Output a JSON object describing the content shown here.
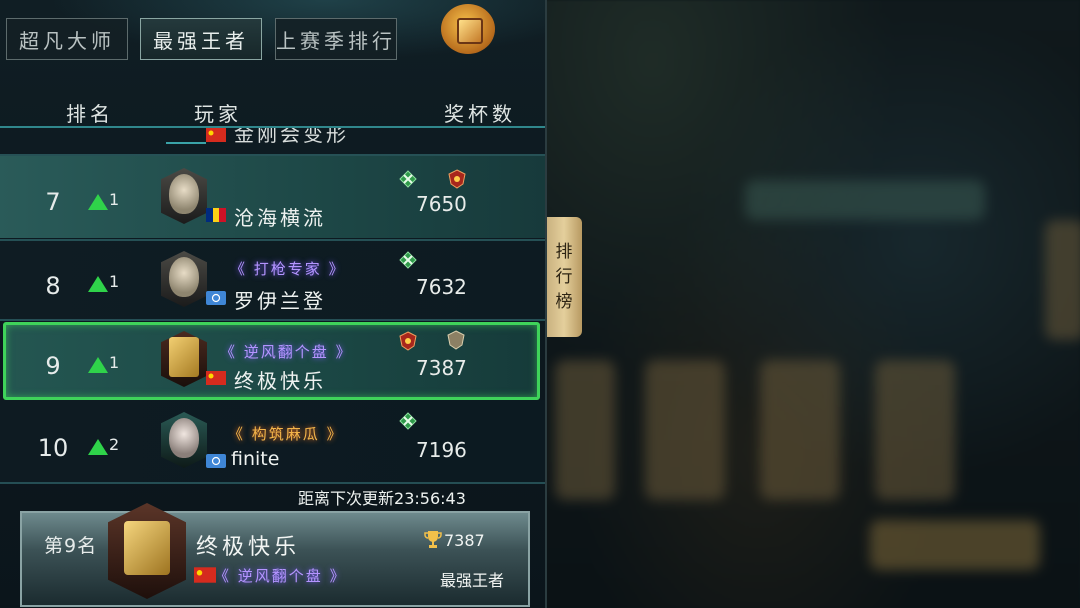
{
  "tabs": [
    {
      "label": "超凡大师"
    },
    {
      "label": "最强王者"
    },
    {
      "label": "上赛季排行"
    }
  ],
  "headers": {
    "rank": "排名",
    "player": "玩家",
    "trophies": "奖杯数"
  },
  "partial_row": {
    "name": "金刚会变形"
  },
  "rows": [
    {
      "rank": "7",
      "delta": "1",
      "title": "",
      "name": "沧海横流",
      "trophies": "7650"
    },
    {
      "rank": "8",
      "delta": "1",
      "title": "打枪专家",
      "name": "罗伊兰登",
      "trophies": "7632"
    },
    {
      "rank": "9",
      "delta": "1",
      "title": "逆风翻个盘",
      "name": "终极快乐",
      "trophies": "7387"
    },
    {
      "rank": "10",
      "delta": "2",
      "title": "构筑麻瓜",
      "name": "finite",
      "trophies": "7196"
    }
  ],
  "update_label": "距离下次更新",
  "update_time": "23:56:43",
  "me": {
    "rank_label": "第9名",
    "name": "终极快乐",
    "title": "逆风翻个盘",
    "trophies": "7387",
    "tier": "最强王者"
  },
  "side_tab": {
    "c1": "排",
    "c2": "行",
    "c3": "榜"
  },
  "colors": {
    "accent_green": "#2fd34a",
    "highlight_border": "#3fd35a",
    "row_teal": "#1d4a49"
  }
}
